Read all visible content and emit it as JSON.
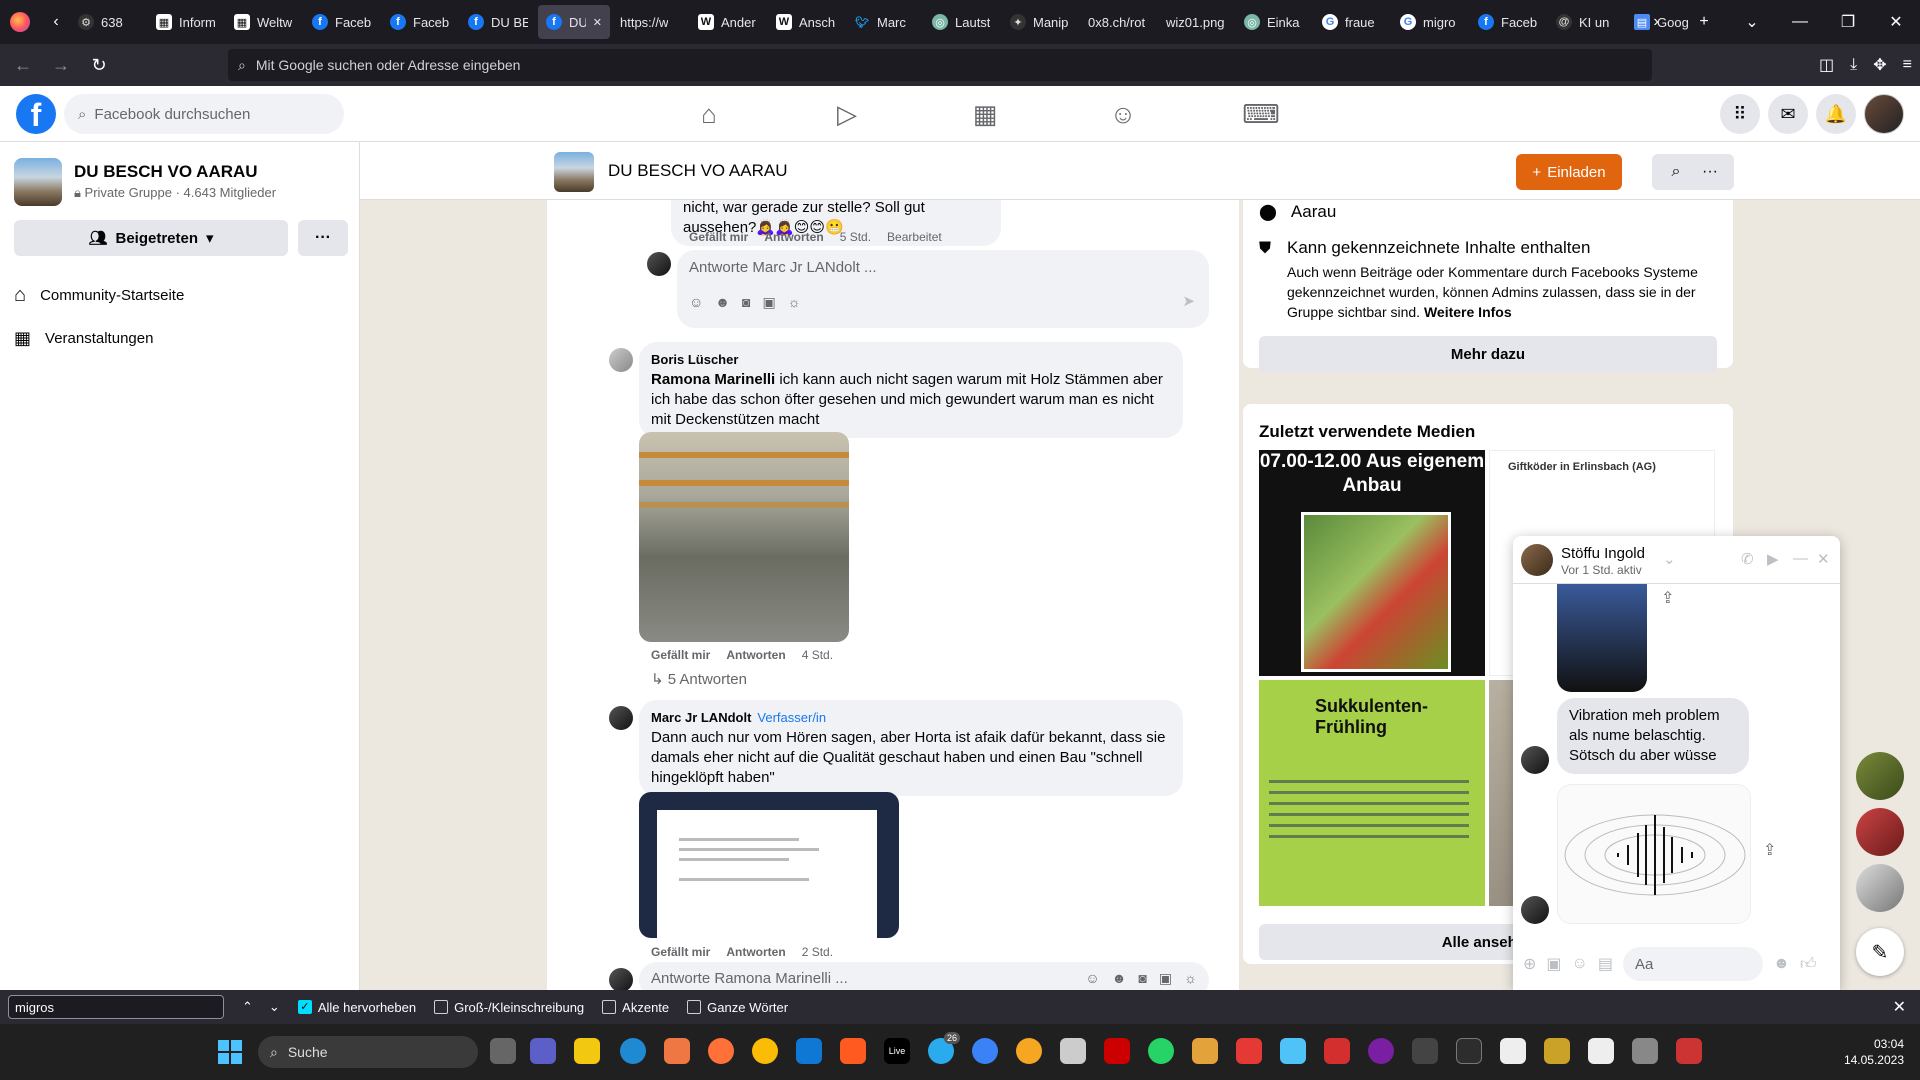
{
  "browser": {
    "tabs": [
      {
        "label": "638",
        "icon": "gear-icon"
      },
      {
        "label": "Inform",
        "icon": "news-icon"
      },
      {
        "label": "Weltw",
        "icon": "news-icon"
      },
      {
        "label": "Faceb",
        "icon": "facebook-icon"
      },
      {
        "label": "Faceb",
        "icon": "facebook-icon"
      },
      {
        "label": "DU BE",
        "icon": "facebook-icon"
      },
      {
        "label": "DU",
        "icon": "facebook-icon",
        "active": true
      },
      {
        "label": "https://w",
        "icon": "none"
      },
      {
        "label": "Ander",
        "icon": "wikipedia-icon"
      },
      {
        "label": "Ansch",
        "icon": "wikipedia-icon"
      },
      {
        "label": "Marc",
        "icon": "twitter-icon"
      },
      {
        "label": "Lautst",
        "icon": "chatgpt-icon"
      },
      {
        "label": "Manip",
        "icon": "app-icon"
      },
      {
        "label": "0x8.ch/rot",
        "icon": "none"
      },
      {
        "label": "wiz01.png",
        "icon": "none"
      },
      {
        "label": "Einka",
        "icon": "chatgpt-icon"
      },
      {
        "label": "fraue",
        "icon": "google-icon"
      },
      {
        "label": "migro",
        "icon": "google-icon"
      },
      {
        "label": "Faceb",
        "icon": "facebook-icon"
      },
      {
        "label": "KI un",
        "icon": "at-icon"
      },
      {
        "label": "Goog",
        "icon": "docs-icon"
      }
    ],
    "url_placeholder": "Mit Google suchen oder Adresse eingeben"
  },
  "facebook": {
    "search_placeholder": "Facebook durchsuchen"
  },
  "group": {
    "name": "DU BESCH VO AARAU",
    "meta": "Private Gruppe · 4.643 Mitglieder",
    "joined_label": "Beigetreten",
    "nav": [
      {
        "label": "Community-Startseite",
        "icon": "home-icon"
      },
      {
        "label": "Veranstaltungen",
        "icon": "calendar-grid-icon"
      }
    ],
    "invite_label": "Einladen"
  },
  "comments": {
    "top_text": "nicht, war gerade zur stelle? Soll gut aussehen?🙇‍♀️🙇‍♀️😊😊😬",
    "top_actions": {
      "like": "Gefällt mir",
      "reply": "Antworten",
      "time": "5 Std.",
      "edited": "Bearbeitet"
    },
    "reply_placeholder_1": "Antworte Marc Jr LANdolt ...",
    "boris": {
      "author": "Boris Lüscher",
      "mention": "Ramona Marinelli",
      "text": " ich kann auch nicht sagen warum mit Holz Stämmen aber ich habe das schon öfter gesehen und mich gewundert warum man es nicht mit Deckenstützen macht",
      "like": "Gefällt mir",
      "reply": "Antworten",
      "time": "4 Std.",
      "replies": "5 Antworten"
    },
    "marc": {
      "author": "Marc Jr LANdolt",
      "badge": "Verfasser/in",
      "text": "Dann auch nur vom Hören sagen, aber Horta ist afaik dafür bekannt, dass sie damals eher nicht auf die Qualität geschaut haben und einen Bau \"schnell hingeklöpft haben\"",
      "like": "Gefällt mir",
      "reply": "Antworten",
      "time": "2 Std."
    },
    "reply_placeholder_2": "Antworte Ramona Marinelli ..."
  },
  "about": {
    "location": "Aarau",
    "flag_title": "Kann gekennzeichnete Inhalte enthalten",
    "flag_text": "Auch wenn Beiträge oder Kommentare durch Facebooks Systeme gekennzeichnet wurden, können Admins zulassen, dass sie in der Gruppe sichtbar sind.",
    "more_info": "Weitere Infos",
    "more_button": "Mehr dazu"
  },
  "media": {
    "title": "Zuletzt verwendete Medien",
    "tile1_text": "07.00-12.00 Aus eigenem Anbau",
    "tile2_text": "Giftköder in Erlinsbach (AG)",
    "tile3_text": "Sukkulenten-Frühling",
    "see_all": "Alle ansehen"
  },
  "chat": {
    "name": "Stöffu Ingold",
    "status": "Vor 1 Std. aktiv",
    "message": "Vibration  meh problem als  nume belaschtig. Sötsch du aber wüsse",
    "input_placeholder": "Aa"
  },
  "findbar": {
    "query": "migros",
    "highlight_all": "Alle hervorheben",
    "match_case": "Groß-/Kleinschreibung",
    "accents": "Akzente",
    "whole_words": "Ganze Wörter"
  },
  "taskbar": {
    "search": "Suche",
    "time": "03:04",
    "date": "14.05.2023",
    "telegram_badge": "26"
  }
}
